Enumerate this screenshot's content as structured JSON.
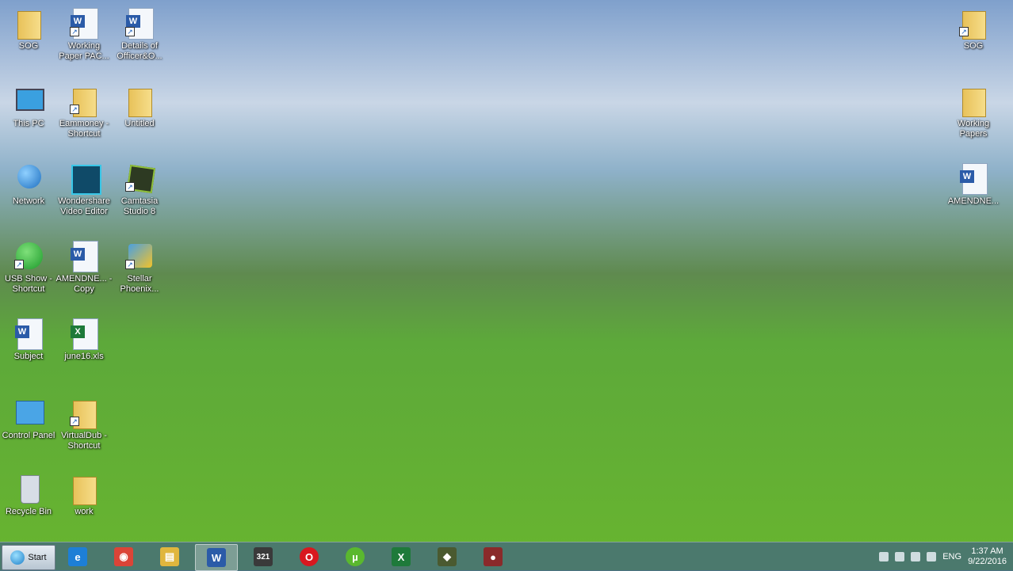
{
  "desktop_icons": [
    {
      "name": "SOG",
      "type": "user-folder"
    },
    {
      "name": "Working Paper PAC...",
      "type": "word-doc"
    },
    {
      "name": "Details of Officer&O...",
      "type": "word-doc"
    },
    {
      "name": "This PC",
      "type": "pc"
    },
    {
      "name": "Eammoney - Shortcut",
      "type": "folder"
    },
    {
      "name": "Untitled",
      "type": "folder"
    },
    {
      "name": "Network",
      "type": "network"
    },
    {
      "name": "Wondershare Video Editor",
      "type": "video-editor"
    },
    {
      "name": "Camtasia Studio 8",
      "type": "camtasia"
    },
    {
      "name": "USB Show - Shortcut",
      "type": "usb-show"
    },
    {
      "name": "AMENDNE... - Copy",
      "type": "word-doc"
    },
    {
      "name": "Stellar Phoenix...",
      "type": "stellar"
    },
    {
      "name": "Subject",
      "type": "word-doc"
    },
    {
      "name": "june16.xls",
      "type": "excel-doc"
    },
    {
      "name": "Control Panel",
      "type": "control-panel"
    },
    {
      "name": "VirtualDub - Shortcut",
      "type": "folder"
    },
    {
      "name": "Recycle Bin",
      "type": "recycle-bin"
    },
    {
      "name": "work",
      "type": "folder"
    },
    {
      "name": "SOG",
      "type": "folder"
    },
    {
      "name": "Working Papers",
      "type": "folder"
    },
    {
      "name": "AMENDNE...",
      "type": "word-doc"
    }
  ],
  "taskbar": {
    "start_label": "Start",
    "pinned": [
      {
        "id": "ie",
        "icon": "internet-explorer-icon",
        "color": "#1d7fd6",
        "glyph": "e",
        "active": false
      },
      {
        "id": "chrome",
        "icon": "chrome-icon",
        "color": "#db4437",
        "glyph": "◉",
        "active": false
      },
      {
        "id": "explorer",
        "icon": "file-explorer-icon",
        "color": "#e0b63d",
        "glyph": "▤",
        "active": false
      },
      {
        "id": "word",
        "icon": "word-icon",
        "color": "#2b5ba8",
        "glyph": "W",
        "active": true
      },
      {
        "id": "video",
        "icon": "video-editor-icon",
        "color": "#3a3a3a",
        "glyph": "321",
        "active": false
      },
      {
        "id": "opera",
        "icon": "opera-icon",
        "color": "#d8181f",
        "glyph": "O",
        "active": false
      },
      {
        "id": "utorrent",
        "icon": "utorrent-icon",
        "color": "#5ab82e",
        "glyph": "µ",
        "active": false
      },
      {
        "id": "excel",
        "icon": "excel-icon",
        "color": "#1e7a3a",
        "glyph": "X",
        "active": false
      },
      {
        "id": "camtasia",
        "icon": "camtasia-icon",
        "color": "#4a5a30",
        "glyph": "◆",
        "active": false
      },
      {
        "id": "recorder",
        "icon": "camtasia-recorder-icon",
        "color": "#8a2a2a",
        "glyph": "●",
        "active": false
      }
    ],
    "language": "ENG",
    "time": "1:37 AM",
    "date": "9/22/2016"
  }
}
